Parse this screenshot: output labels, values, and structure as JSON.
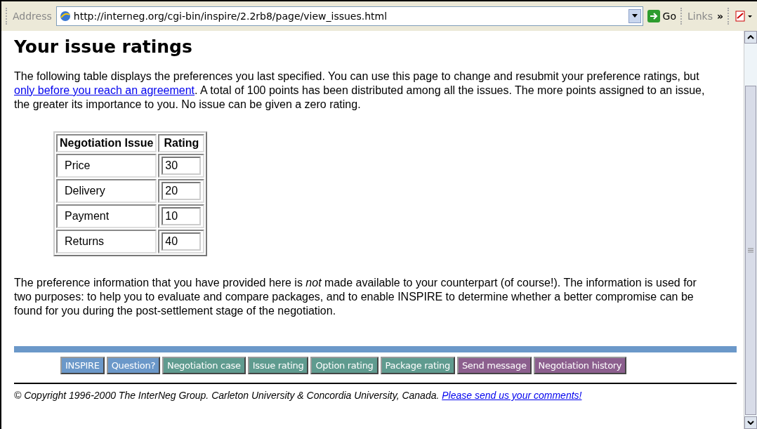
{
  "toolbar": {
    "address_label": "Address",
    "url": "http://interneg.org/cgi-bin/inspire/2.2rb8/page/view_issues.html",
    "go_label": "Go",
    "links_label": "Links",
    "chevron": "»"
  },
  "page": {
    "heading": "Your issue ratings",
    "intro": {
      "before": "The following table displays the preferences you last specified. You can use this page to change and resubmit your preference ratings, but ",
      "link": "only before you reach an agreement",
      "after": ". A total of 100 points has been distributed among all the issues. The more points assigned to an issue, the greater its importance to you. No issue can be given a zero rating."
    },
    "table": {
      "columns": [
        "Negotiation Issue",
        "Rating"
      ],
      "rows": [
        {
          "issue": "Price",
          "rating": "30"
        },
        {
          "issue": "Delivery",
          "rating": "20"
        },
        {
          "issue": "Payment",
          "rating": "10"
        },
        {
          "issue": "Returns",
          "rating": "40"
        }
      ]
    },
    "note": "The preference information that you have provided here is *not*  made available to your counterpart (of course!). The information is used for two purposes: to help you to evaluate and compare packages, and to enable INSPIRE to determine whether a better compromise can be found for you during the post-settlement stage of the negotiation.",
    "nav": [
      {
        "label": "INSPIRE",
        "color": "#6b98c9"
      },
      {
        "label": "Question?",
        "color": "#6b98c9"
      },
      {
        "label": "Negotiation case",
        "color": "#5f9b8f"
      },
      {
        "label": "Issue rating",
        "color": "#5f9b8f"
      },
      {
        "label": "Option rating",
        "color": "#5f9b8f"
      },
      {
        "label": "Package rating",
        "color": "#5f9b8f"
      },
      {
        "label": "Send message",
        "color": "#8c5f8e"
      },
      {
        "label": "Negotiation history",
        "color": "#8c5f8e"
      }
    ],
    "copyright": "© Copyright 1996-2000 The InterNeg Group. Carleton University & Concordia University, Canada.",
    "comments_link": "Please send us your comments!"
  }
}
